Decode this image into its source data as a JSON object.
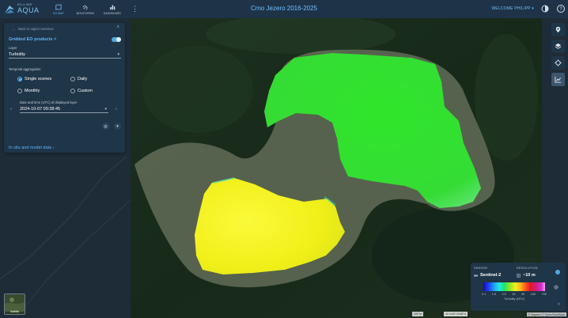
{
  "app": {
    "brand_small": "EO-4-SEE",
    "brand_name": "AQUA",
    "title": "Crno Jezero 2016-2025",
    "welcome": "WELCOME PHILIPP"
  },
  "nav": [
    {
      "label": "EO MAP",
      "icon": "map-icon",
      "active": true
    },
    {
      "label": "MONITORING",
      "icon": "satellite-icon",
      "active": false
    },
    {
      "label": "DASHBOARD",
      "icon": "bar-chart-icon",
      "active": false
    }
  ],
  "panel": {
    "back_label": "Back to region overview",
    "section_title": "Gridded EO products",
    "layer_label": "Layer",
    "layer_value": "Turbidity",
    "temporal_label": "Temporal aggregation",
    "options": [
      {
        "label": "Single scenes",
        "selected": true
      },
      {
        "label": "Daily",
        "selected": false
      },
      {
        "label": "Monthly",
        "selected": false
      },
      {
        "label": "Custom",
        "selected": false
      }
    ],
    "date_label": "Date and time (UTC) of displayed layer",
    "date_value": "2024-10-07 09:38:45",
    "insitu_label": "In situ and model data"
  },
  "legend": {
    "sensor_label": "SENSOR",
    "sensor_value": "Sentinel-2",
    "resolution_label": "RESOLUTION",
    "resolution_value": "~10 m",
    "ticks": [
      "0.1",
      "1.5",
      "2.5",
      "15",
      "50",
      "150",
      "+50"
    ],
    "unit": "Turbidity (NTU)"
  },
  "basemap": {
    "label": "Satellite"
  },
  "footer": {
    "scale": "100 m",
    "coords": "42.1432 18.5874",
    "attribution": "© Mapbox © OpenStreetMap"
  },
  "colors": {
    "accent": "#5fb6ff",
    "header_bg": "#1e3347",
    "panel_bg": "#1f3548",
    "lake_upper": "#33e52c",
    "lake_lower": "#f4f21c"
  }
}
